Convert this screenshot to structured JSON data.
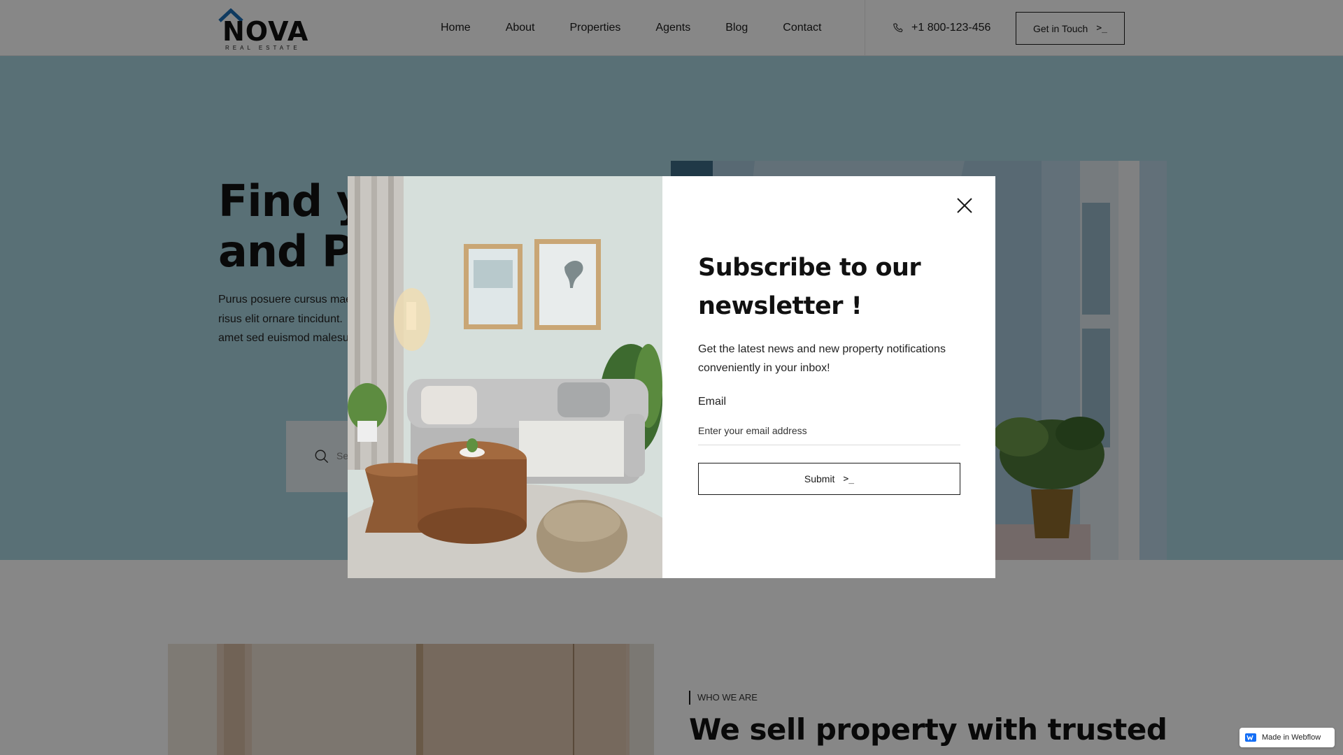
{
  "header": {
    "logo": {
      "word": "NOVA",
      "sub": "REAL ESTATE",
      "roof_color": "#1e6fb5"
    },
    "nav": [
      "Home",
      "About",
      "Properties",
      "Agents",
      "Blog",
      "Contact"
    ],
    "phone": "+1 800-123-456",
    "phone_icon": "phone-icon",
    "cta_label": "Get in Touch",
    "cta_icon": ">_"
  },
  "hero": {
    "title_line1": "Find yo",
    "title_line2": "and Pro",
    "text_line1": "Purus posuere cursus mae",
    "text_line2": "risus elit ornare tincidunt.",
    "text_line3": "amet sed euismod malesu",
    "search_placeholder": "Se",
    "search_icon": "search-icon",
    "background": "#a9d3df"
  },
  "about": {
    "tag": "WHO WE ARE",
    "title": "We sell property with trusted"
  },
  "modal": {
    "title_line1": "Subscribe to our",
    "title_line2": "newsletter !",
    "text": "Get the latest news and new property notifications conveniently in your inbox!",
    "email_label": "Email",
    "email_placeholder": "Enter your email address",
    "submit_label": "Submit",
    "submit_icon": ">_",
    "close_icon": "close-icon"
  },
  "badge": {
    "label": "Made in Webflow",
    "icon": "webflow-icon"
  }
}
